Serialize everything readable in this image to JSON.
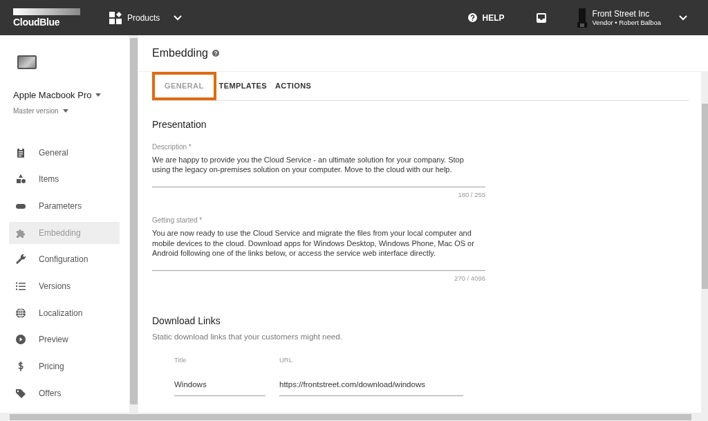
{
  "header": {
    "logo": "CloudBlue",
    "products_menu": "Products",
    "help": "HELP",
    "account": {
      "name": "Front Street Inc",
      "subtitle": "Vendor • Robert Balboa"
    }
  },
  "sidebar": {
    "product_name": "Apple Macbook Pro",
    "version": "Master version",
    "items": [
      {
        "label": "General",
        "selected": false
      },
      {
        "label": "Items",
        "selected": false
      },
      {
        "label": "Parameters",
        "selected": false
      },
      {
        "label": "Embedding",
        "selected": true
      },
      {
        "label": "Configuration",
        "selected": false
      },
      {
        "label": "Versions",
        "selected": false
      },
      {
        "label": "Localization",
        "selected": false
      },
      {
        "label": "Preview",
        "selected": false
      },
      {
        "label": "Pricing",
        "selected": false
      },
      {
        "label": "Offers",
        "selected": false
      }
    ]
  },
  "page": {
    "title": "Embedding",
    "tabs": [
      {
        "label": "GENERAL",
        "selected": true,
        "highlighted": true
      },
      {
        "label": "TEMPLATES",
        "selected": false,
        "highlighted": false
      },
      {
        "label": "ACTIONS",
        "selected": false,
        "highlighted": false
      }
    ],
    "presentation": {
      "heading": "Presentation",
      "fields": [
        {
          "label": "Description *",
          "value": "We are happy to provide you the Cloud Service - an ultimate solution for your company. Stop using the legacy on-premises solution on your computer. Move to the cloud with our help.",
          "counter": "180 / 255"
        },
        {
          "label": "Getting started *",
          "value": "You are now ready to use the Cloud Service and migrate the files from your local computer and mobile devices to the cloud. Download apps for Windows Desktop, Windows Phone, Mac OS or Android following one of the links below, or access the service web interface directly.",
          "counter": "270 / 4096"
        }
      ]
    },
    "download_links": {
      "heading": "Download Links",
      "subtitle": "Static download links that your customers might need.",
      "columns": [
        "Title",
        "URL"
      ],
      "rows": [
        {
          "title": "Windows",
          "url": "https://frontstreet.com/download/windows"
        }
      ]
    }
  }
}
